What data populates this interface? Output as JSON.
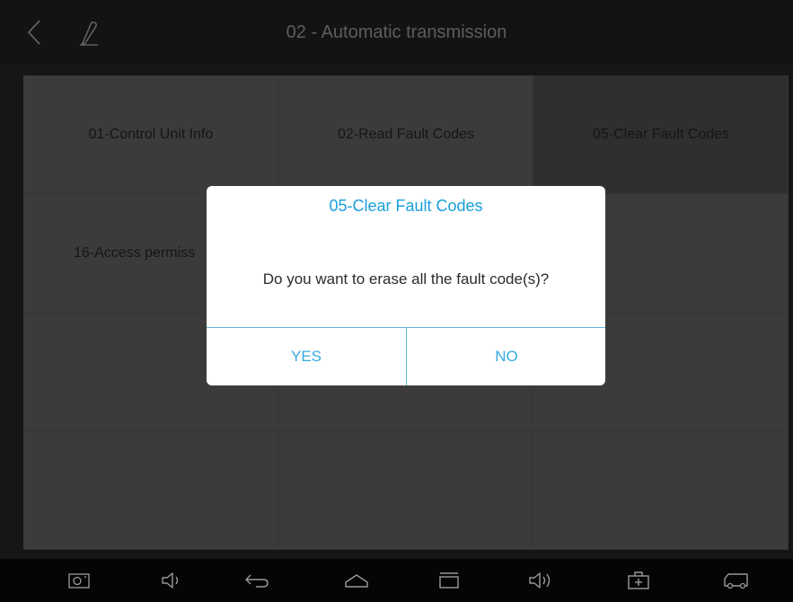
{
  "header": {
    "title": "02 - Automatic transmission"
  },
  "menu": {
    "items": [
      "01-Control Unit Info",
      "02-Read Fault Codes",
      "05-Clear Fault Codes",
      "16-Access permiss",
      "",
      "",
      "",
      "",
      "",
      "",
      "",
      ""
    ],
    "active_index": 2
  },
  "dialog": {
    "title": "05-Clear Fault Codes",
    "message": "Do you want to erase all the fault code(s)?",
    "yes_label": "YES",
    "no_label": "NO",
    "accent_color": "#1a9fd9"
  },
  "icons": {
    "back": "chevron-left-icon",
    "edit": "pencil-icon",
    "screenshot": "camera-icon",
    "volume_down": "volume-down-icon",
    "back_nav": "back-arrow-icon",
    "home": "home-icon",
    "recents": "recents-icon",
    "volume_up": "volume-up-icon",
    "toolbox": "toolbox-icon",
    "vehicle": "truck-icon"
  }
}
